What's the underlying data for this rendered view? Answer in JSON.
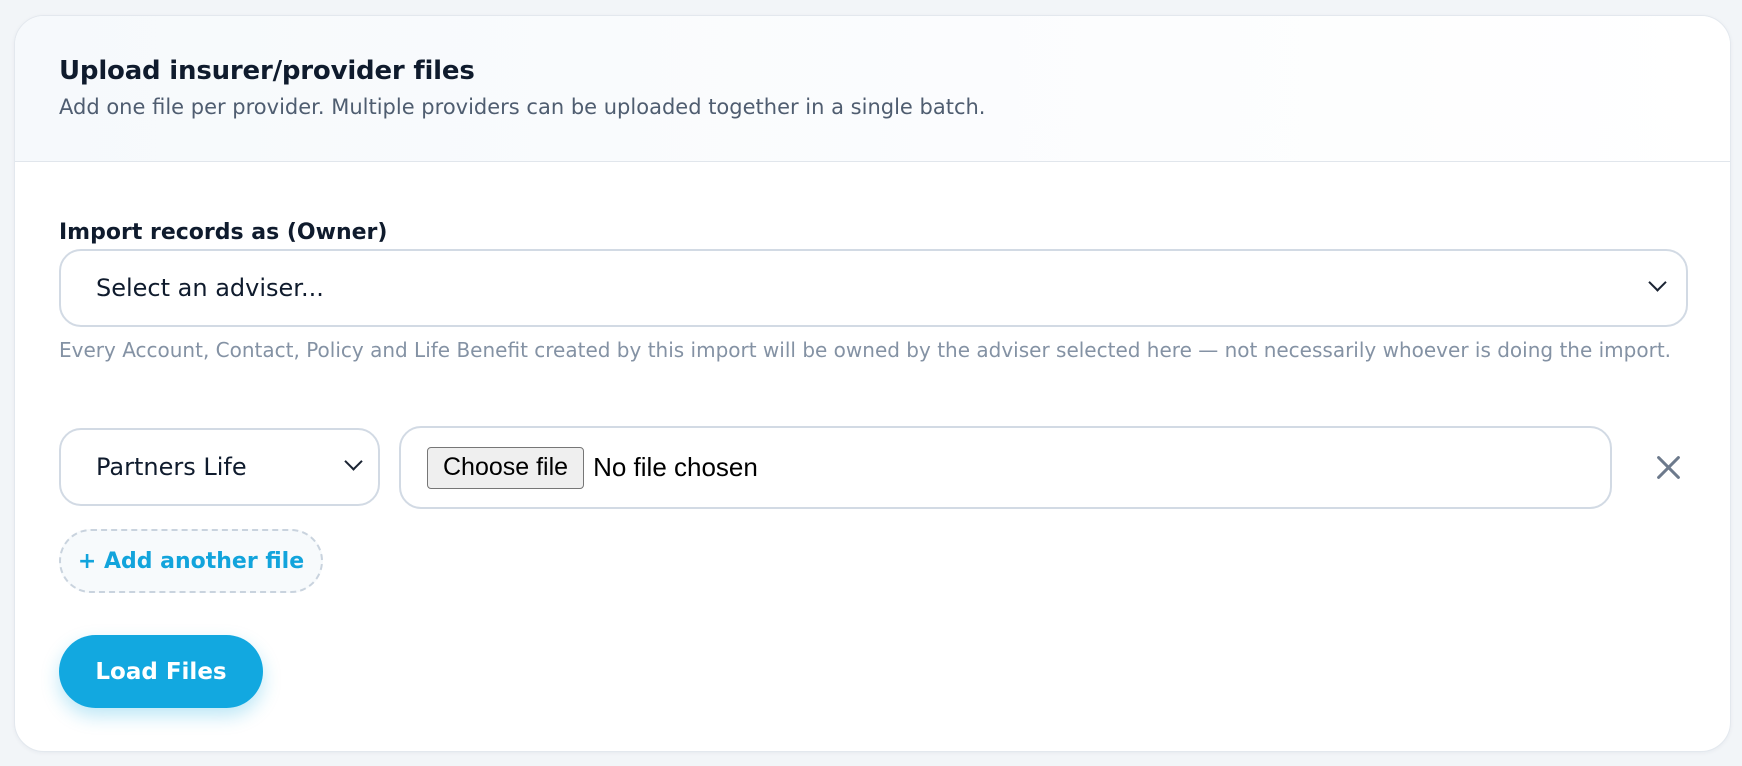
{
  "header": {
    "title": "Upload insurer/provider files",
    "subtitle": "Add one file per provider. Multiple providers can be uploaded together in a single batch."
  },
  "owner": {
    "label": "Import records as (Owner)",
    "select_value": "Select an adviser...",
    "helper_text": "Every Account, Contact, Policy and Life Benefit created by this import will be owned by the adviser selected here — not necessarily whoever is doing the import."
  },
  "file_rows": [
    {
      "provider": "Partners Life",
      "choose_label": "Choose file",
      "file_status": "No file chosen"
    }
  ],
  "actions": {
    "add_file_label": "+ Add another file",
    "load_label": "Load Files"
  },
  "icons": {
    "select_arrow": "chevron-down-icon",
    "remove": "close-icon"
  },
  "colors": {
    "accent": "#12a8e0",
    "link": "#12a4dc"
  }
}
